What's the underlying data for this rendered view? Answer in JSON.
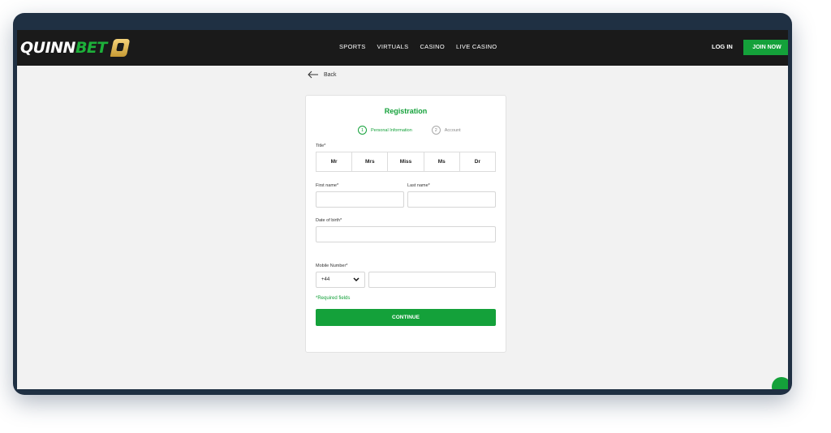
{
  "navbar": {
    "logo_prefix": "QUINN",
    "logo_suffix": "BET",
    "links": [
      "SPORTS",
      "VIRTUALS",
      "CASINO",
      "LIVE CASINO"
    ],
    "login_label": "LOG IN",
    "join_label": "JOIN NOW"
  },
  "back_label": "Back",
  "form": {
    "title": "Registration",
    "steps": [
      {
        "number": "1",
        "label": "Personal Information",
        "active": true
      },
      {
        "number": "2",
        "label": "Account",
        "active": false
      }
    ],
    "title_label": "Title*",
    "title_options": [
      "Mr",
      "Mrs",
      "Miss",
      "Ms",
      "Dr"
    ],
    "first_name_label": "First name*",
    "first_name_value": "",
    "last_name_label": "Last name*",
    "last_name_value": "",
    "dob_label": "Date of birth*",
    "dob_value": "",
    "mobile_label": "Mobile Number*",
    "country_code": "+44",
    "mobile_value": "",
    "required_note": "*Required fields",
    "continue_label": "CONTINUE"
  },
  "colors": {
    "accent": "#14a13a",
    "navbar": "#1a1a1a",
    "background": "#f2f2f2"
  }
}
